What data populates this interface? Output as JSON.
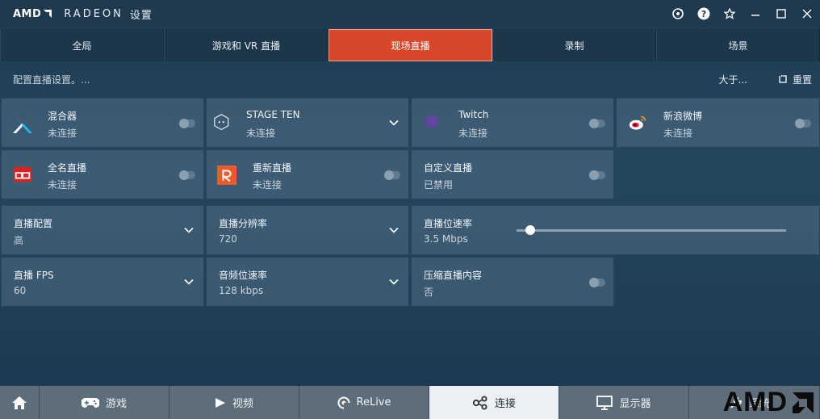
{
  "titlebar": {
    "brand": "AMD",
    "product": "RADEON",
    "settings": "设置"
  },
  "tabs": [
    {
      "label": "全局",
      "active": false
    },
    {
      "label": "游戏和 VR 直播",
      "active": false
    },
    {
      "label": "现场直播",
      "active": true
    },
    {
      "label": "录制",
      "active": false
    },
    {
      "label": "场景",
      "active": false
    }
  ],
  "subbar": {
    "hint": "配置直播设置。...",
    "about": "大于...",
    "reset": "重置"
  },
  "services": [
    {
      "name": "混合器",
      "status": "未连接",
      "icon": "mixer-icon",
      "control": "toggle"
    },
    {
      "name": "STAGE TEN",
      "status": "未连接",
      "icon": "stage-ten-icon",
      "control": "dropdown"
    },
    {
      "name": "Twitch",
      "status": "未连接",
      "icon": "twitch-icon",
      "control": "toggle"
    },
    {
      "name": "新浪微博",
      "status": "未连接",
      "icon": "weibo-icon",
      "control": "toggle"
    },
    {
      "name": "全名直播",
      "status": "未连接",
      "icon": "quanmin-icon",
      "control": "toggle"
    },
    {
      "name": "重新直播",
      "status": "未连接",
      "icon": "restream-icon",
      "control": "toggle"
    },
    {
      "name": "自定义直播",
      "status": "已禁用",
      "icon": "",
      "control": "toggle"
    }
  ],
  "settings": {
    "profile": {
      "label": "直播配置",
      "value": "高"
    },
    "resolution": {
      "label": "直播分辨率",
      "value": "720"
    },
    "bitrate": {
      "label": "直播位速率",
      "value": "3.5 Mbps",
      "level": 0.05
    },
    "fps": {
      "label": "直播 FPS",
      "value": "60"
    },
    "audio_bitrate": {
      "label": "音频位速率",
      "value": "128 kbps"
    },
    "compress": {
      "label": "压缩直播内容",
      "value": "否"
    }
  },
  "bottomnav": [
    {
      "label": "",
      "icon": "home-icon"
    },
    {
      "label": "游戏",
      "icon": "gamepad-icon"
    },
    {
      "label": "视频",
      "icon": "play-icon"
    },
    {
      "label": "ReLive",
      "icon": "relive-icon"
    },
    {
      "label": "连接",
      "icon": "connect-icon",
      "active": true
    },
    {
      "label": "显示器",
      "icon": "monitor-icon"
    },
    {
      "label": "系统",
      "icon": "system-icon"
    }
  ],
  "bottom_logo": "AMD",
  "colors": {
    "accent": "#d9472b",
    "mixer": "#1fbaed",
    "twitch": "#6441a4",
    "restream": "#ef5a2a",
    "weibo": "#e6162d"
  }
}
